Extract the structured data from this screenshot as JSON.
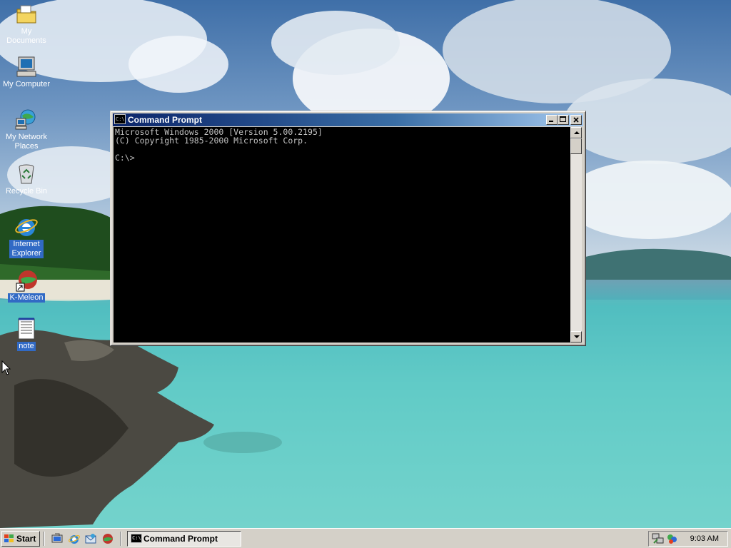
{
  "desktop": {
    "icons": [
      {
        "label": "My Documents",
        "icon": "folder-documents-icon"
      },
      {
        "label": "My Computer",
        "icon": "computer-icon"
      },
      {
        "label": "My Network Places",
        "icon": "network-places-icon"
      },
      {
        "label": "Recycle Bin",
        "icon": "recycle-bin-icon"
      },
      {
        "label": "Internet Explorer",
        "icon": "internet-explorer-icon"
      },
      {
        "label": "K-Meleon",
        "icon": "k-meleon-icon"
      },
      {
        "label": "note",
        "icon": "notepad-file-icon"
      }
    ]
  },
  "window": {
    "title": "Command Prompt",
    "icon_text": "C:\\",
    "console_text": "Microsoft Windows 2000 [Version 5.00.2195]\n(C) Copyright 1985-2000 Microsoft Corp.\n\nC:\\>"
  },
  "taskbar": {
    "start_label": "Start",
    "task_label": "Command Prompt",
    "clock": "9:03 AM",
    "quick_launch": [
      "show-desktop-icon",
      "internet-explorer-icon",
      "outlook-express-icon",
      "k-meleon-icon"
    ]
  },
  "colors": {
    "title_active_start": "#0a246a",
    "title_active_end": "#a6caf0",
    "console_bg": "#000000",
    "console_fg": "#c0c0c0",
    "chrome": "#d4d0c8",
    "selection": "#316ac5"
  }
}
